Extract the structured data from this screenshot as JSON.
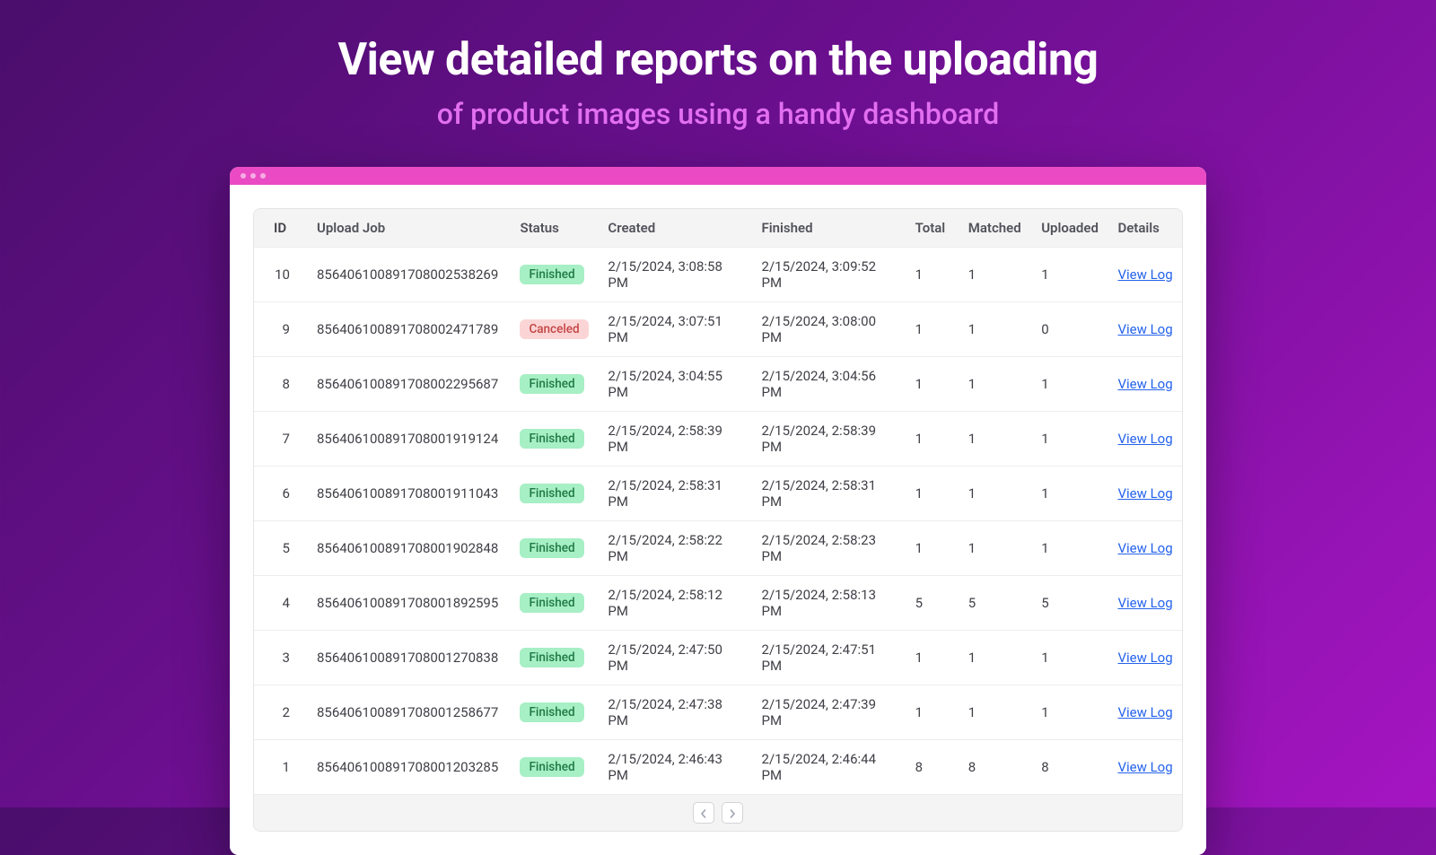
{
  "hero": {
    "title": "View detailed reports on the uploading",
    "subtitle": "of product images using a handy dashboard"
  },
  "table": {
    "headers": {
      "id": "ID",
      "job": "Upload Job",
      "status": "Status",
      "created": "Created",
      "finished": "Finished",
      "total": "Total",
      "matched": "Matched",
      "uploaded": "Uploaded",
      "details": "Details"
    },
    "view_log_label": "View Log",
    "status_labels": {
      "finished": "Finished",
      "canceled": "Canceled"
    },
    "rows": [
      {
        "id": "10",
        "job": "856406100891708002538269",
        "status": "finished",
        "created": "2/15/2024, 3:08:58 PM",
        "finished": "2/15/2024, 3:09:52 PM",
        "total": "1",
        "matched": "1",
        "uploaded": "1"
      },
      {
        "id": "9",
        "job": "856406100891708002471789",
        "status": "canceled",
        "created": "2/15/2024, 3:07:51 PM",
        "finished": "2/15/2024, 3:08:00 PM",
        "total": "1",
        "matched": "1",
        "uploaded": "0"
      },
      {
        "id": "8",
        "job": "856406100891708002295687",
        "status": "finished",
        "created": "2/15/2024, 3:04:55 PM",
        "finished": "2/15/2024, 3:04:56 PM",
        "total": "1",
        "matched": "1",
        "uploaded": "1"
      },
      {
        "id": "7",
        "job": "856406100891708001919124",
        "status": "finished",
        "created": "2/15/2024, 2:58:39 PM",
        "finished": "2/15/2024, 2:58:39 PM",
        "total": "1",
        "matched": "1",
        "uploaded": "1"
      },
      {
        "id": "6",
        "job": "856406100891708001911043",
        "status": "finished",
        "created": "2/15/2024, 2:58:31 PM",
        "finished": "2/15/2024, 2:58:31 PM",
        "total": "1",
        "matched": "1",
        "uploaded": "1"
      },
      {
        "id": "5",
        "job": "856406100891708001902848",
        "status": "finished",
        "created": "2/15/2024, 2:58:22 PM",
        "finished": "2/15/2024, 2:58:23 PM",
        "total": "1",
        "matched": "1",
        "uploaded": "1"
      },
      {
        "id": "4",
        "job": "856406100891708001892595",
        "status": "finished",
        "created": "2/15/2024, 2:58:12 PM",
        "finished": "2/15/2024, 2:58:13 PM",
        "total": "5",
        "matched": "5",
        "uploaded": "5"
      },
      {
        "id": "3",
        "job": "856406100891708001270838",
        "status": "finished",
        "created": "2/15/2024, 2:47:50 PM",
        "finished": "2/15/2024, 2:47:51 PM",
        "total": "1",
        "matched": "1",
        "uploaded": "1"
      },
      {
        "id": "2",
        "job": "856406100891708001258677",
        "status": "finished",
        "created": "2/15/2024, 2:47:38 PM",
        "finished": "2/15/2024, 2:47:39 PM",
        "total": "1",
        "matched": "1",
        "uploaded": "1"
      },
      {
        "id": "1",
        "job": "856406100891708001203285",
        "status": "finished",
        "created": "2/15/2024, 2:46:43 PM",
        "finished": "2/15/2024, 2:46:44 PM",
        "total": "8",
        "matched": "8",
        "uploaded": "8"
      }
    ]
  }
}
